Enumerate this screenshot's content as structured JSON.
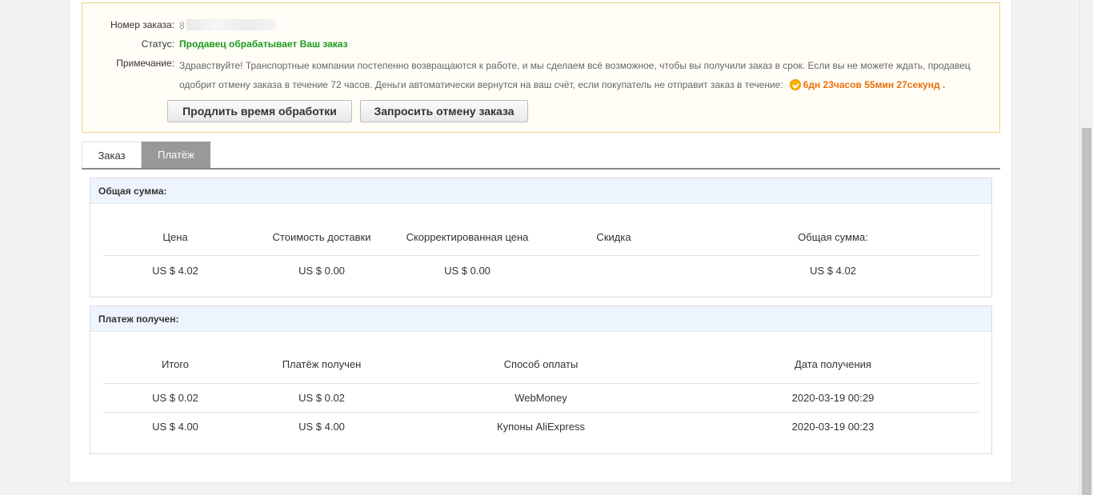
{
  "order": {
    "number_label": "Номер заказа:",
    "number_value": "8",
    "status_label": "Статус:",
    "status_value": "Продавец обрабатывает Ваш заказ",
    "note_label": "Примечание:",
    "note_text": "Здравствуйте! Транспортные компании постепенно возвращаются к работе, и мы сделаем всё возможное, чтобы вы получили заказ в срок. Если вы не можете ждать, продавец одобрит отмену заказа в течение 72 часов. Деньги автоматически вернутся на ваш счёт, если покупатель не отправит заказ в течение:",
    "timer": "6дн 23часов 55мин 27секунд",
    "timer_suffix": ".",
    "extend_button": "Продлить время обработки",
    "cancel_button": "Запросить отмену заказа"
  },
  "tabs": [
    {
      "label": "Заказ",
      "active": false
    },
    {
      "label": "Платёж",
      "active": true
    }
  ],
  "total_panel": {
    "title": "Общая сумма:",
    "headers": [
      "Цена",
      "Стоимость доставки",
      "Скорректированная цена",
      "Скидка",
      "Общая сумма:"
    ],
    "row": [
      "US $ 4.02",
      "US $ 0.00",
      "US $ 0.00",
      "",
      "US $ 4.02"
    ]
  },
  "payment_panel": {
    "title": "Платеж получен:",
    "headers": [
      "Итого",
      "Платёж получен",
      "Способ оплаты",
      "Дата получения"
    ],
    "rows": [
      [
        "US $ 0.02",
        "US $ 0.02",
        "WebMoney",
        "2020-03-19 00:29"
      ],
      [
        "US $ 4.00",
        "US $ 4.00",
        "Купоны AliExpress",
        "2020-03-19 00:23"
      ]
    ]
  },
  "colors": {
    "status": "#1c9a1c",
    "timer": "#e8700e",
    "panel_header_bg": "#eef4fd",
    "status_box_border": "#f0d28c"
  }
}
